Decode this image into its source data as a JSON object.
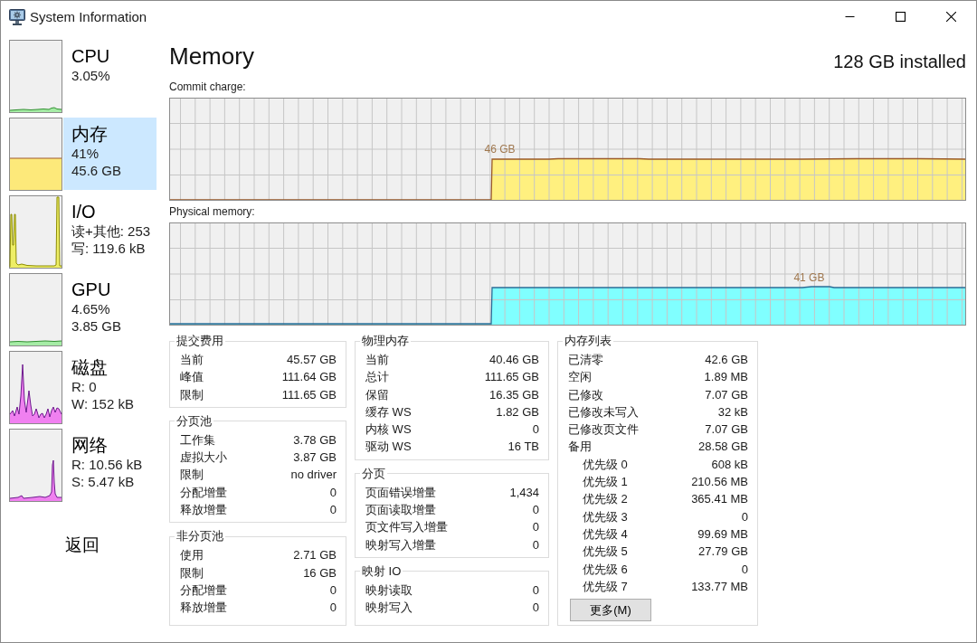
{
  "window": {
    "title": "System Information"
  },
  "sidebar": {
    "items": [
      {
        "kind": "cpu",
        "title": "CPU",
        "lines": [
          "3.05%"
        ],
        "selected": false
      },
      {
        "kind": "memory",
        "title": "内存",
        "lines": [
          "41%",
          "45.6 GB"
        ],
        "selected": true
      },
      {
        "kind": "io",
        "title": "I/O",
        "lines": [
          "读+其他: 253",
          "写: 119.6 kB"
        ],
        "selected": false
      },
      {
        "kind": "gpu",
        "title": "GPU",
        "lines": [
          "4.65%",
          "3.85 GB"
        ],
        "selected": false
      },
      {
        "kind": "disk",
        "title": "磁盘",
        "lines": [
          "R: 0",
          "W: 152 kB"
        ],
        "selected": false
      },
      {
        "kind": "network",
        "title": "网络",
        "lines": [
          "R: 10.56 kB",
          "S: 5.47 kB"
        ],
        "selected": false
      }
    ],
    "back_link": "返回"
  },
  "header": {
    "title": "Memory",
    "installed": "128 GB installed"
  },
  "graphs": [
    {
      "kind": "commit",
      "label": "Commit charge:",
      "reading": "46 GB"
    },
    {
      "kind": "physical",
      "label": "Physical memory:",
      "reading": "41 GB"
    }
  ],
  "columns": [
    {
      "groups": [
        {
          "title": "提交费用",
          "rows": [
            {
              "label": "当前",
              "value": "45.57 GB"
            },
            {
              "label": "峰值",
              "value": "111.64 GB"
            },
            {
              "label": "限制",
              "value": "111.65 GB"
            }
          ]
        },
        {
          "title": "分页池",
          "rows": [
            {
              "label": "工作集",
              "value": "3.78 GB"
            },
            {
              "label": "虚拟大小",
              "value": "3.87 GB"
            },
            {
              "label": "限制",
              "value": "no driver"
            },
            {
              "label": "分配增量",
              "value": "0"
            },
            {
              "label": "释放增量",
              "value": "0"
            }
          ]
        },
        {
          "title": "非分页池",
          "rows": [
            {
              "label": "使用",
              "value": "2.71 GB"
            },
            {
              "label": "限制",
              "value": "16 GB"
            },
            {
              "label": "分配增量",
              "value": "0"
            },
            {
              "label": "释放增量",
              "value": "0"
            }
          ]
        }
      ]
    },
    {
      "groups": [
        {
          "title": "物理内存",
          "rows": [
            {
              "label": "当前",
              "value": "40.46 GB"
            },
            {
              "label": "总计",
              "value": "111.65 GB"
            },
            {
              "label": "保留",
              "value": "16.35 GB"
            },
            {
              "label": "缓存 WS",
              "value": "1.82 GB"
            },
            {
              "label": "内核 WS",
              "value": "0"
            },
            {
              "label": "驱动 WS",
              "value": "16 TB"
            }
          ]
        },
        {
          "title": "分页",
          "rows": [
            {
              "label": "页面错误增量",
              "value": "1,434"
            },
            {
              "label": "页面读取增量",
              "value": "0"
            },
            {
              "label": "页文件写入增量",
              "value": "0"
            },
            {
              "label": "映射写入增量",
              "value": "0"
            }
          ]
        },
        {
          "title": "映射 IO",
          "rows": [
            {
              "label": "映射读取",
              "value": "0"
            },
            {
              "label": "映射写入",
              "value": "0"
            }
          ]
        }
      ]
    },
    {
      "groups": [
        {
          "title": "内存列表",
          "rows": [
            {
              "label": "已清零",
              "value": "42.6 GB"
            },
            {
              "label": "空闲",
              "value": "1.89 MB"
            },
            {
              "label": "已修改",
              "value": "7.07 GB"
            },
            {
              "label": "已修改未写入",
              "value": "32 kB"
            },
            {
              "label": "已修改页文件",
              "value": "7.07 GB"
            },
            {
              "label": "备用",
              "value": "28.58 GB",
              "children": [
                {
                  "label": "优先级 0",
                  "value": "608 kB"
                },
                {
                  "label": "优先级 1",
                  "value": "210.56 MB"
                },
                {
                  "label": "优先级 2",
                  "value": "365.41 MB"
                },
                {
                  "label": "优先级 3",
                  "value": "0"
                },
                {
                  "label": "优先级 4",
                  "value": "99.69 MB"
                },
                {
                  "label": "优先级 5",
                  "value": "27.79 GB"
                },
                {
                  "label": "优先级 6",
                  "value": "0"
                },
                {
                  "label": "优先级 7",
                  "value": "133.77 MB"
                }
              ]
            }
          ],
          "button": "更多(M)"
        }
      ]
    }
  ]
}
